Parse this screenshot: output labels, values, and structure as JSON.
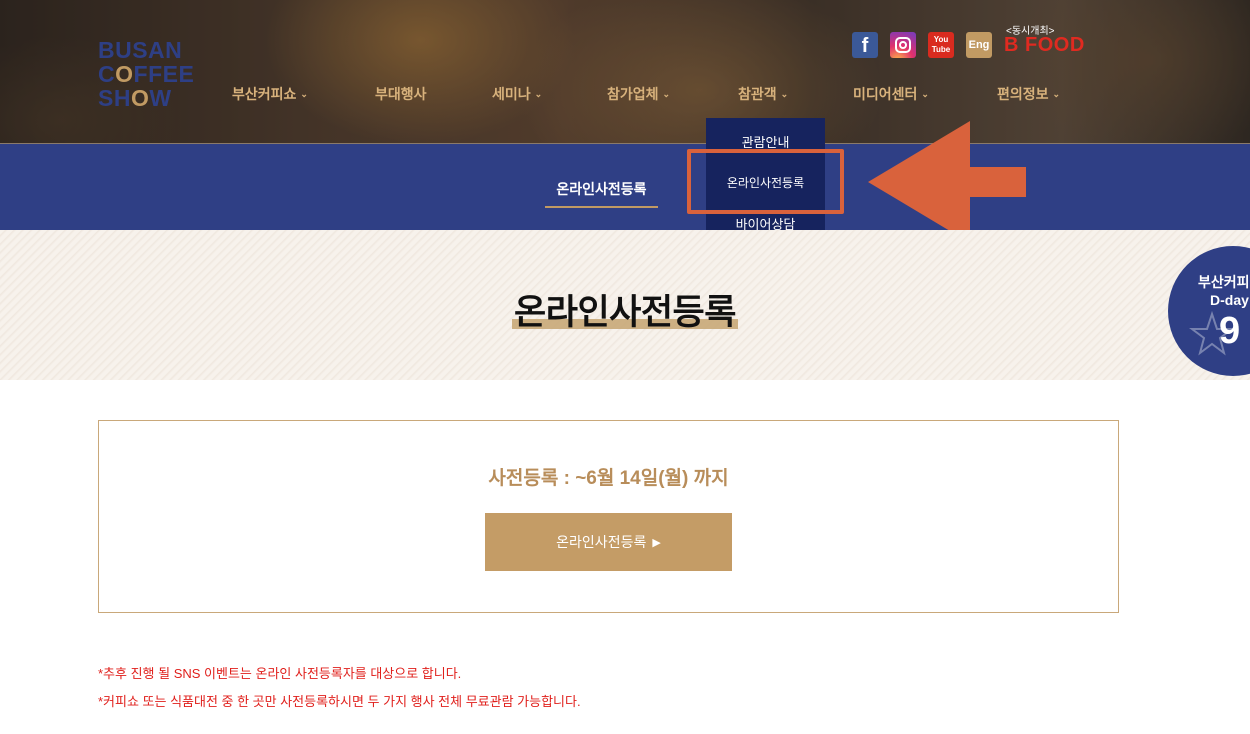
{
  "header": {
    "logo": {
      "line1": "BUSAN",
      "line2_pre": "C",
      "line2_accent": "O",
      "line2_post": "FFEE",
      "line3_pre": "SH",
      "line3_accent": "O",
      "line3_post": "W"
    },
    "nav": [
      {
        "label": "부산커피쇼",
        "has_dropdown": true,
        "chevron": "⌄"
      },
      {
        "label": "부대행사",
        "has_dropdown": false
      },
      {
        "label": "세미나",
        "has_dropdown": true,
        "chevron": "⌄"
      },
      {
        "label": "참가업체",
        "has_dropdown": true,
        "chevron": "⌄"
      },
      {
        "label": "참관객",
        "has_dropdown": true,
        "chevron": "⌄"
      },
      {
        "label": "미디어센터",
        "has_dropdown": true,
        "chevron": "⌄"
      },
      {
        "label": "편의정보",
        "has_dropdown": true,
        "chevron": "⌄"
      }
    ],
    "sns": {
      "facebook": {
        "glyph": "f",
        "icon": "facebook-icon"
      },
      "instagram": {
        "icon": "instagram-icon"
      },
      "youtube": {
        "line1": "You",
        "line2": "Tube",
        "icon": "youtube-icon"
      },
      "english": {
        "label": "Eng"
      }
    },
    "bofood": {
      "tag": "<동시개최>",
      "text": "B  FOOD"
    }
  },
  "subnav": {
    "active_tab": "온라인사전등록"
  },
  "dropdown": {
    "items": [
      "관람안내",
      "온라인사전등록",
      "바이어상담"
    ],
    "highlighted_index": 1
  },
  "page": {
    "title": "온라인사전등록"
  },
  "dday": {
    "title": "부산커피",
    "label": "D-day",
    "number": "9"
  },
  "registration": {
    "info": "사전등록 : ~6월 14일(월) 까지",
    "button_label": "온라인사전등록",
    "button_arrow": "▶"
  },
  "notes": [
    "*추후 진행 될 SNS 이벤트는 온라인 사전등록자를 대상으로 합니다.",
    "*커피쇼 또는 식품대전 중 한 곳만 사전등록하시면 두 가지 행사 전체 무료관람 가능합니다."
  ],
  "colors": {
    "brand_navy": "#2f3f85",
    "dropdown_navy": "#16235e",
    "gold": "#c49c66",
    "annotation_orange": "#d9623c",
    "note_red": "#e0201c"
  }
}
